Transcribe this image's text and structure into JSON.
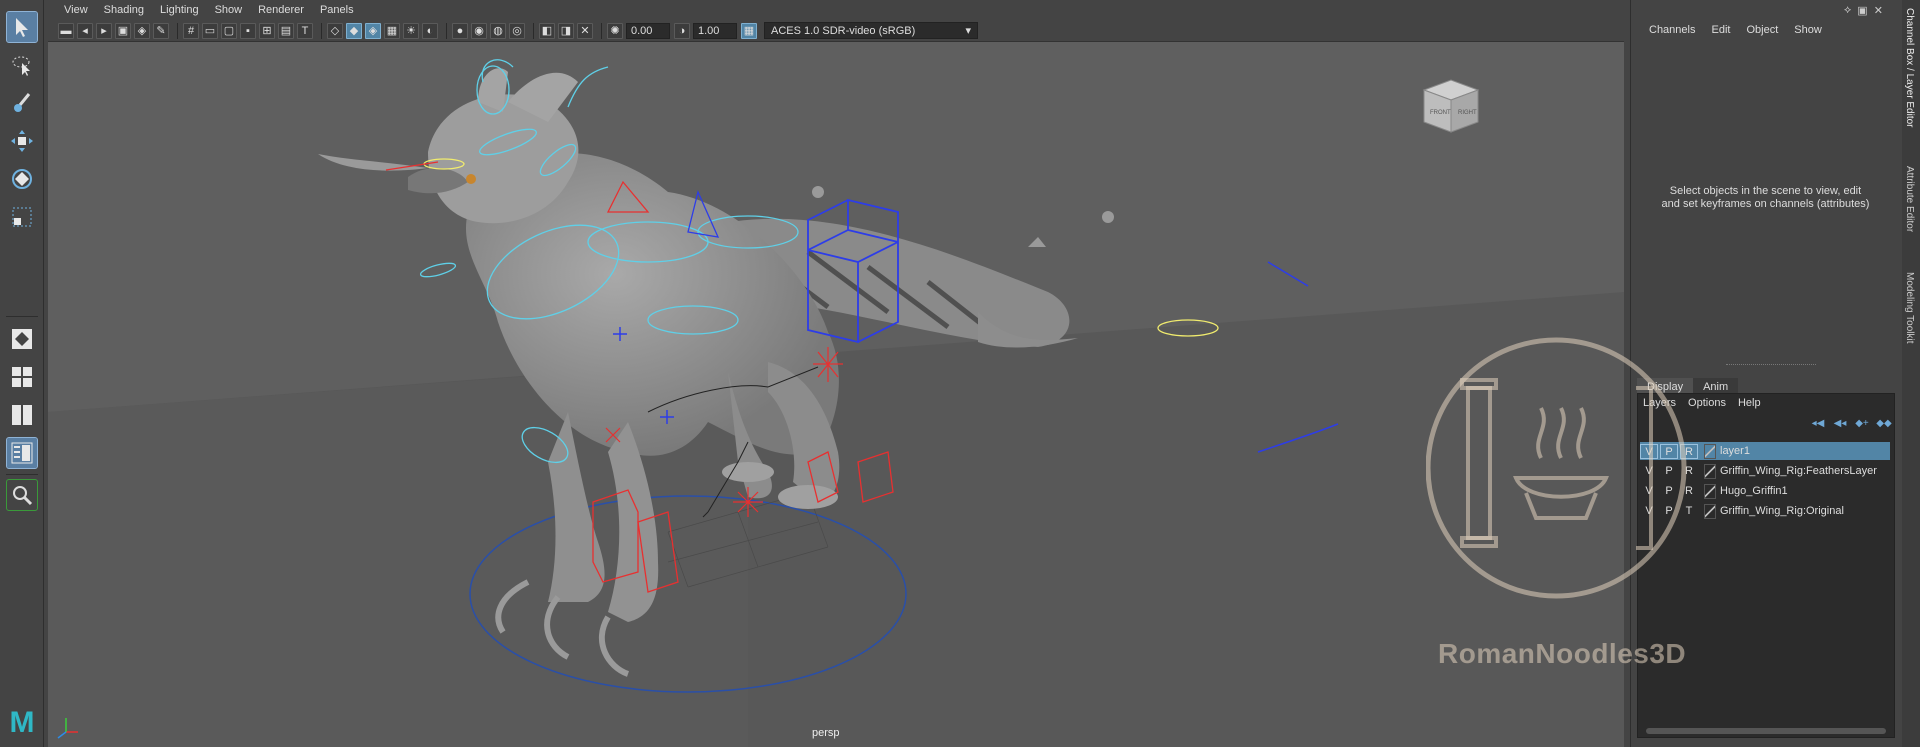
{
  "viewport": {
    "menu": [
      "View",
      "Shading",
      "Lighting",
      "Show",
      "Renderer",
      "Panels"
    ],
    "exposure": "0.00",
    "gamma": "1.00",
    "color_space": "ACES 1.0 SDR-video (sRGB)",
    "camera_label": "persp",
    "viewcube": {
      "front": "FRONT",
      "right": "RIGHT"
    }
  },
  "channel_box": {
    "menu": [
      "Channels",
      "Edit",
      "Object",
      "Show"
    ],
    "message": "Select objects in the scene to view, edit and set keyframes on channels (attributes)"
  },
  "layer_editor": {
    "tabs": [
      "Display",
      "Anim"
    ],
    "menu": [
      "Layers",
      "Options",
      "Help"
    ],
    "layers": [
      {
        "v": "V",
        "p": "P",
        "r": "R",
        "name": "layer1",
        "selected": true
      },
      {
        "v": "V",
        "p": "P",
        "r": "R",
        "name": "Griffin_Wing_Rig:FeathersLayer",
        "selected": false
      },
      {
        "v": "V",
        "p": "P",
        "r": "R",
        "name": "Hugo_Griffin1",
        "selected": false
      },
      {
        "v": "V",
        "p": "P",
        "r": "T",
        "name": "Griffin_Wing_Rig:Original",
        "selected": false
      }
    ]
  },
  "side_tabs": [
    "Channel Box / Layer Editor",
    "Attribute Editor",
    "Modeling Toolkit"
  ],
  "watermark": "RomanNoodles3D",
  "colors": {
    "accent": "#5285a6",
    "viewport_bg": "#5f5f5f",
    "panel_bg": "#444444"
  }
}
